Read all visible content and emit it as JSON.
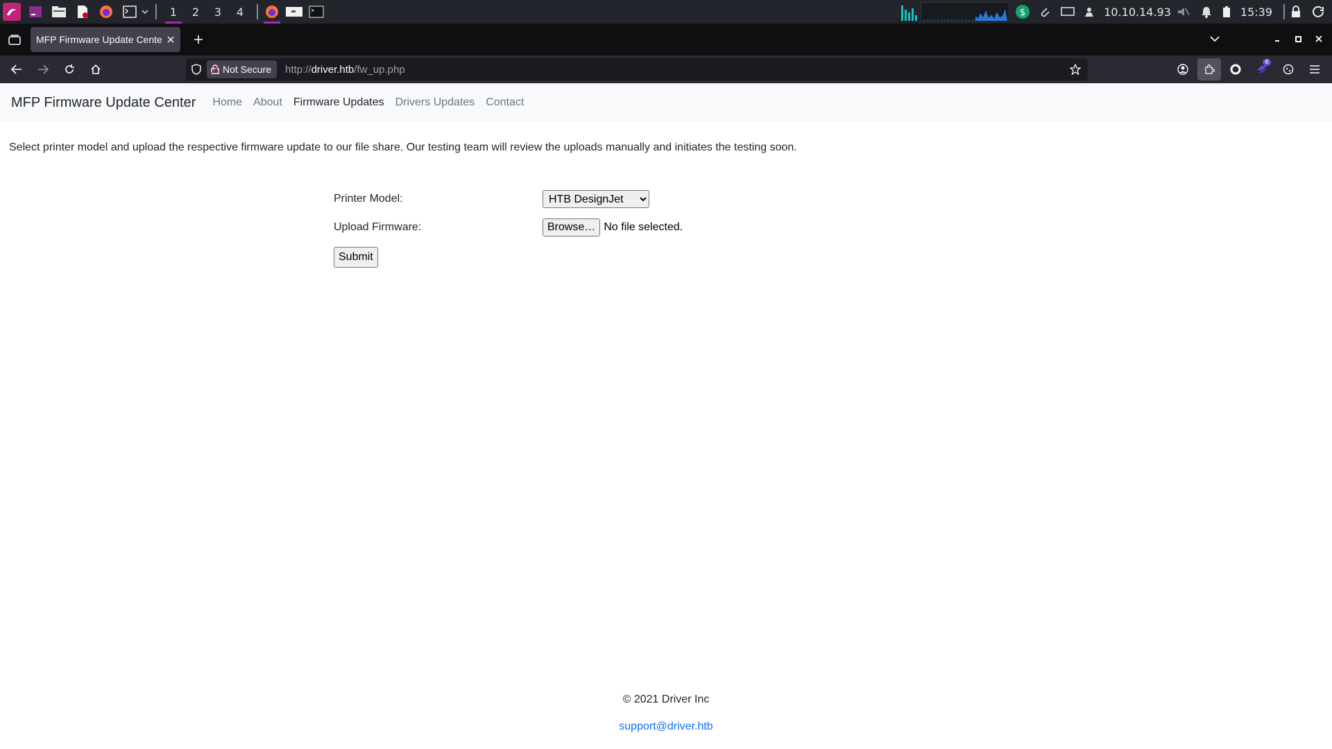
{
  "taskbar": {
    "workspaces": [
      "1",
      "2",
      "3",
      "4"
    ],
    "active_workspace": "1",
    "ip_address": "10.10.14.93",
    "clock": "15:39",
    "accent_color": "#b026b0"
  },
  "browser": {
    "tab_title": "MFP Firmware Update Center",
    "security_label": "Not Secure",
    "url_scheme": "http://",
    "url_host": "driver.htb",
    "url_path": "/fw_up.php",
    "extension_badge": "6"
  },
  "site": {
    "brand": "MFP Firmware Update Center",
    "nav": [
      {
        "label": "Home",
        "active": false
      },
      {
        "label": "About",
        "active": false
      },
      {
        "label": "Firmware Updates",
        "active": true
      },
      {
        "label": "Drivers Updates",
        "active": false
      },
      {
        "label": "Contact",
        "active": false
      }
    ],
    "intro": "Select printer model and upload the respective firmware update to our file share. Our testing team will review the uploads manually and initiates the testing soon.",
    "form": {
      "model_label": "Printer Model:",
      "model_selected": "HTB DesignJet",
      "firmware_label": "Upload Firmware:",
      "browse_label": "Browse…",
      "file_status": "No file selected.",
      "submit_label": "Submit"
    },
    "footer": {
      "copyright": "© 2021 Driver Inc",
      "email": "support@driver.htb"
    }
  }
}
